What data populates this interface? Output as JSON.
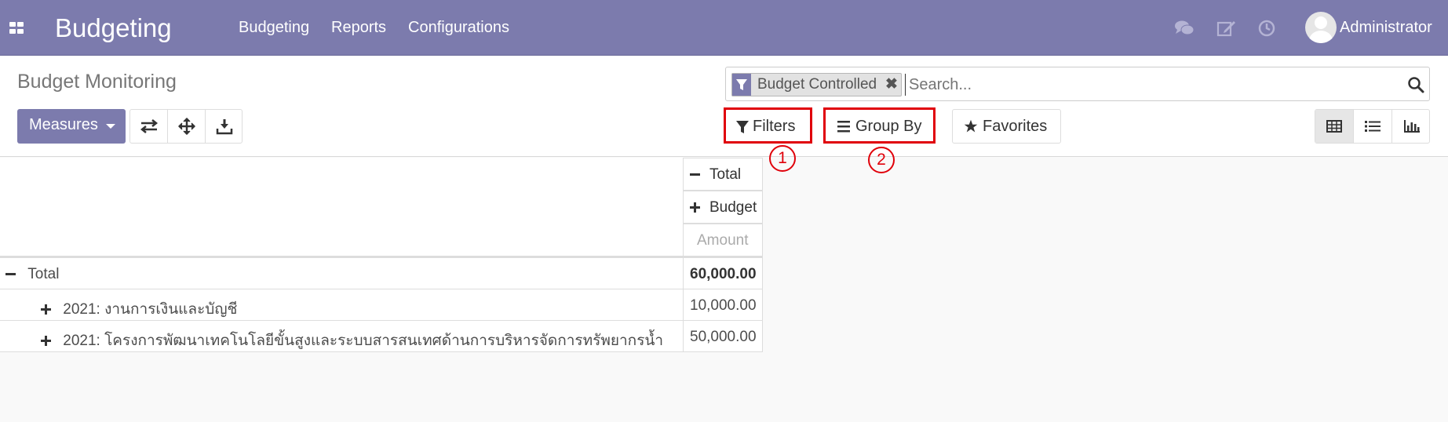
{
  "app": {
    "title": "Budgeting"
  },
  "nav": {
    "menu": [
      "Budgeting",
      "Reports",
      "Configurations"
    ],
    "user": "Administrator"
  },
  "breadcrumb": "Budget Monitoring",
  "search": {
    "facet": "Budget Controlled",
    "remove_glyph": "✖",
    "placeholder": "Search..."
  },
  "toolbar": {
    "measures_label": "Measures",
    "filters_label": "Filters",
    "groupby_label": "Group By",
    "favorites_label": "Favorites"
  },
  "annotations": {
    "filters_number": "1",
    "groupby_number": "2",
    "color": "#e0000a"
  },
  "pivot": {
    "col_headers": {
      "total": "Total",
      "group": "Budget",
      "measure": "Amount"
    },
    "total_row": {
      "label": "Total",
      "value": "60,000.00"
    },
    "rows": [
      {
        "label": "2021: งานการเงินและบัญชี",
        "value": "10,000.00"
      },
      {
        "label": "2021: โครงการพัฒนาเทคโนโลยีขั้นสูงและระบบสารสนเทศด้านการบริหารจัดการทรัพยากรน้ำ",
        "value": "50,000.00"
      }
    ]
  },
  "colors": {
    "navbar": "#7c7bad",
    "primary": "#7c7bad",
    "background": "#f9f9f9"
  },
  "icons": [
    "apps-icon",
    "chat-icon",
    "edit-icon",
    "clock-icon",
    "filter-icon",
    "search-icon",
    "flip-axis-icon",
    "expand-all-icon",
    "download-icon",
    "bars-icon",
    "star-icon",
    "pivot-view-icon",
    "list-view-icon",
    "graph-view-icon"
  ]
}
